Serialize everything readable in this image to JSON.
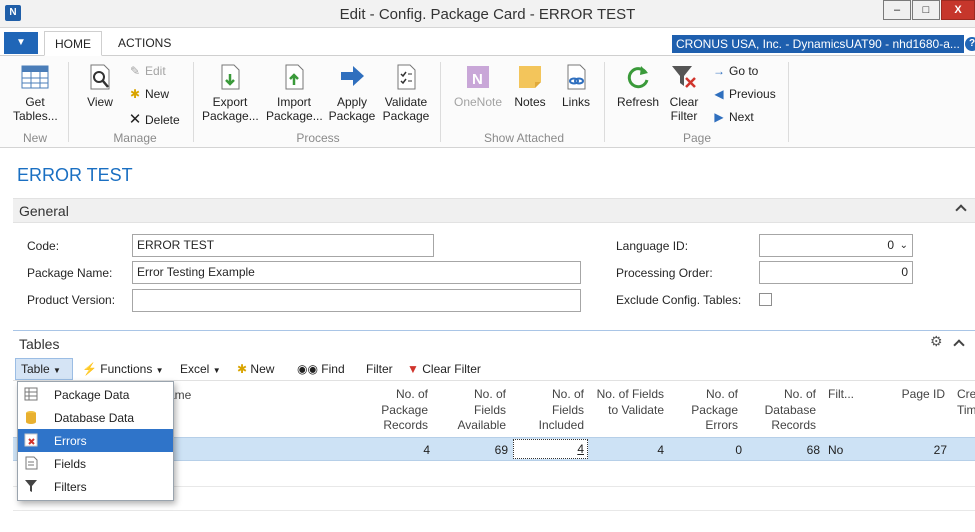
{
  "window": {
    "title": "Edit - Config. Package Card - ERROR TEST",
    "min": "–",
    "max": "□",
    "close": "X"
  },
  "tabs": [
    {
      "label": "HOME"
    },
    {
      "label": "ACTIONS"
    }
  ],
  "company": "CRONUS USA, Inc. - DynamicsUAT90 - nhd1680-a...",
  "ribbon": {
    "new": {
      "get_tables": "Get Tables...",
      "label": "New"
    },
    "manage": {
      "view": "View",
      "edit": "Edit",
      "new": "New",
      "delete": "Delete",
      "label": "Manage"
    },
    "process": {
      "export": "Export Package...",
      "import": "Import Package...",
      "apply": "Apply Package",
      "validate": "Validate Package",
      "label": "Process"
    },
    "show_attached": {
      "onenote": "OneNote",
      "notes": "Notes",
      "links": "Links",
      "label": "Show Attached"
    },
    "page": {
      "refresh": "Refresh",
      "clear_filter": "Clear Filter",
      "go_to": "Go to",
      "previous": "Previous",
      "next": "Next",
      "label": "Page"
    }
  },
  "page_title": "ERROR TEST",
  "general": {
    "label": "General",
    "code_label": "Code:",
    "code": "ERROR TEST",
    "package_name_label": "Package Name:",
    "package_name": "Error Testing Example",
    "product_version_label": "Product Version:",
    "product_version": "",
    "language_id_label": "Language ID:",
    "language_id": "0",
    "processing_order_label": "Processing Order:",
    "processing_order": "0",
    "exclude_label": "Exclude Config. Tables:"
  },
  "tables": {
    "label": "Tables",
    "toolbar": {
      "table": "Table",
      "functions": "Functions",
      "excel": "Excel",
      "new": "New",
      "find": "Find",
      "filter": "Filter",
      "clear_filter": "Clear Filter"
    },
    "columns": {
      "name": "ame",
      "pkg_records": "No. of Package Records",
      "fields_available": "No. of Fields Available",
      "fields_included": "No. of Fields Included",
      "fields_validate": "No. of Fields to Validate",
      "pkg_errors": "No. of Package Errors",
      "db_records": "No. of Database Records",
      "filter": "Filt...",
      "page_id": "Page ID",
      "created": "Cre Tim"
    },
    "row": {
      "pkg_records": "4",
      "fields_available": "69",
      "fields_included": "4",
      "fields_validate": "4",
      "pkg_errors": "0",
      "db_records": "68",
      "filter": "No",
      "page_id": "27"
    },
    "menu": [
      {
        "label": "Package Data"
      },
      {
        "label": "Database Data"
      },
      {
        "label": "Errors"
      },
      {
        "label": "Fields"
      },
      {
        "label": "Filters"
      }
    ]
  }
}
